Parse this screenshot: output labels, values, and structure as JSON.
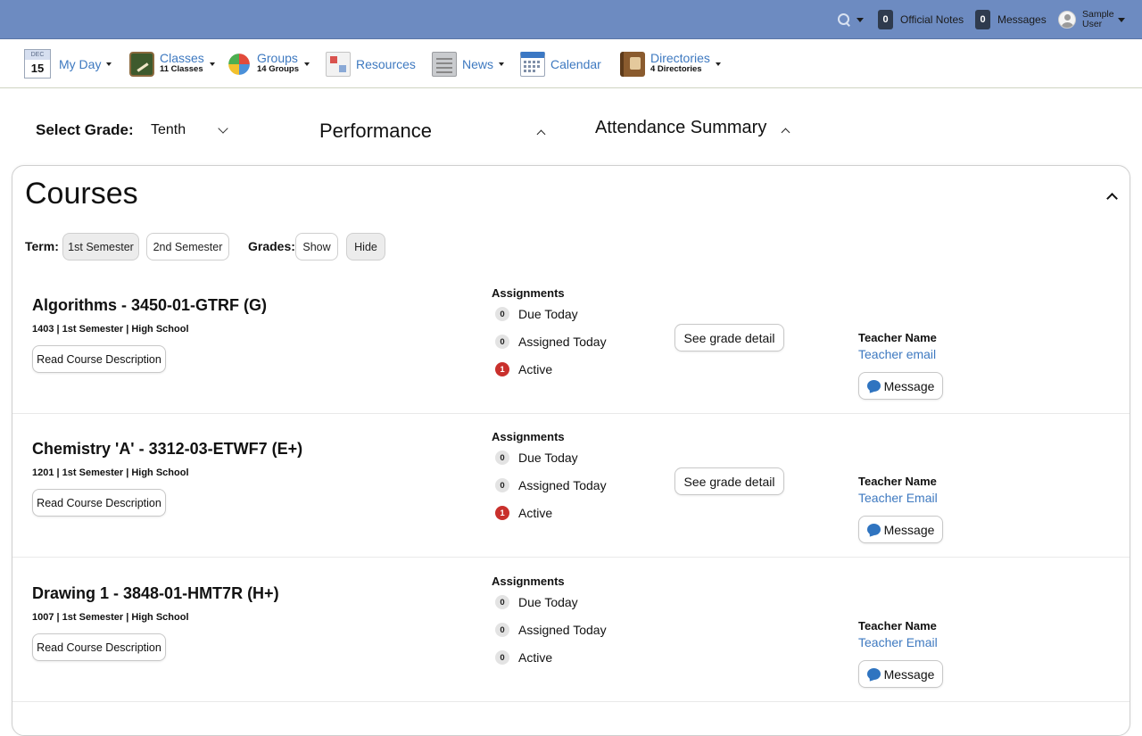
{
  "topbar": {
    "official_notes_count": "0",
    "official_notes_label": "Official Notes",
    "messages_count": "0",
    "messages_label": "Messages",
    "user_name": "Sample User"
  },
  "nav": {
    "myday": {
      "month": "DEC",
      "day": "15",
      "label": "My Day"
    },
    "classes": {
      "label": "Classes",
      "sub": "11 Classes"
    },
    "groups": {
      "label": "Groups",
      "sub": "14 Groups"
    },
    "resources": {
      "label": "Resources"
    },
    "news": {
      "label": "News"
    },
    "calendar": {
      "label": "Calendar"
    },
    "directories": {
      "label": "Directories",
      "sub": "4 Directories"
    }
  },
  "controls": {
    "select_grade_label": "Select Grade:",
    "grade_value": "Tenth",
    "performance_label": "Performance",
    "attendance_label": "Attendance Summary"
  },
  "courses_panel": {
    "title": "Courses",
    "term_label": "Term:",
    "term_options": [
      "1st Semester",
      "2nd Semester"
    ],
    "grades_label": "Grades:",
    "grades_show": "Show",
    "grades_hide": "Hide"
  },
  "labels": {
    "read_desc": "Read Course Description",
    "assignments": "Assignments",
    "due_today": "Due Today",
    "assigned_today": "Assigned Today",
    "active": "Active",
    "see_grade": "See grade detail",
    "teacher_name": "Teacher Name",
    "message": "Message"
  },
  "courses": [
    {
      "name": "Algorithms - 3450-01-GTRF (G)",
      "meta": "1403 | 1st Semester | High School",
      "due_today": "0",
      "assigned_today": "0",
      "active": "1",
      "teacher_email": "Teacher email"
    },
    {
      "name": "Chemistry 'A' - 3312-03-ETWF7 (E+)",
      "meta": "1201 | 1st Semester | High School",
      "due_today": "0",
      "assigned_today": "0",
      "active": "1",
      "teacher_email": "Teacher Email"
    },
    {
      "name": "Drawing 1 - 3848-01-HMT7R (H+)",
      "meta": "1007 | 1st Semester | High School",
      "due_today": "0",
      "assigned_today": "0",
      "active": "0",
      "teacher_email": "Teacher Email"
    }
  ]
}
